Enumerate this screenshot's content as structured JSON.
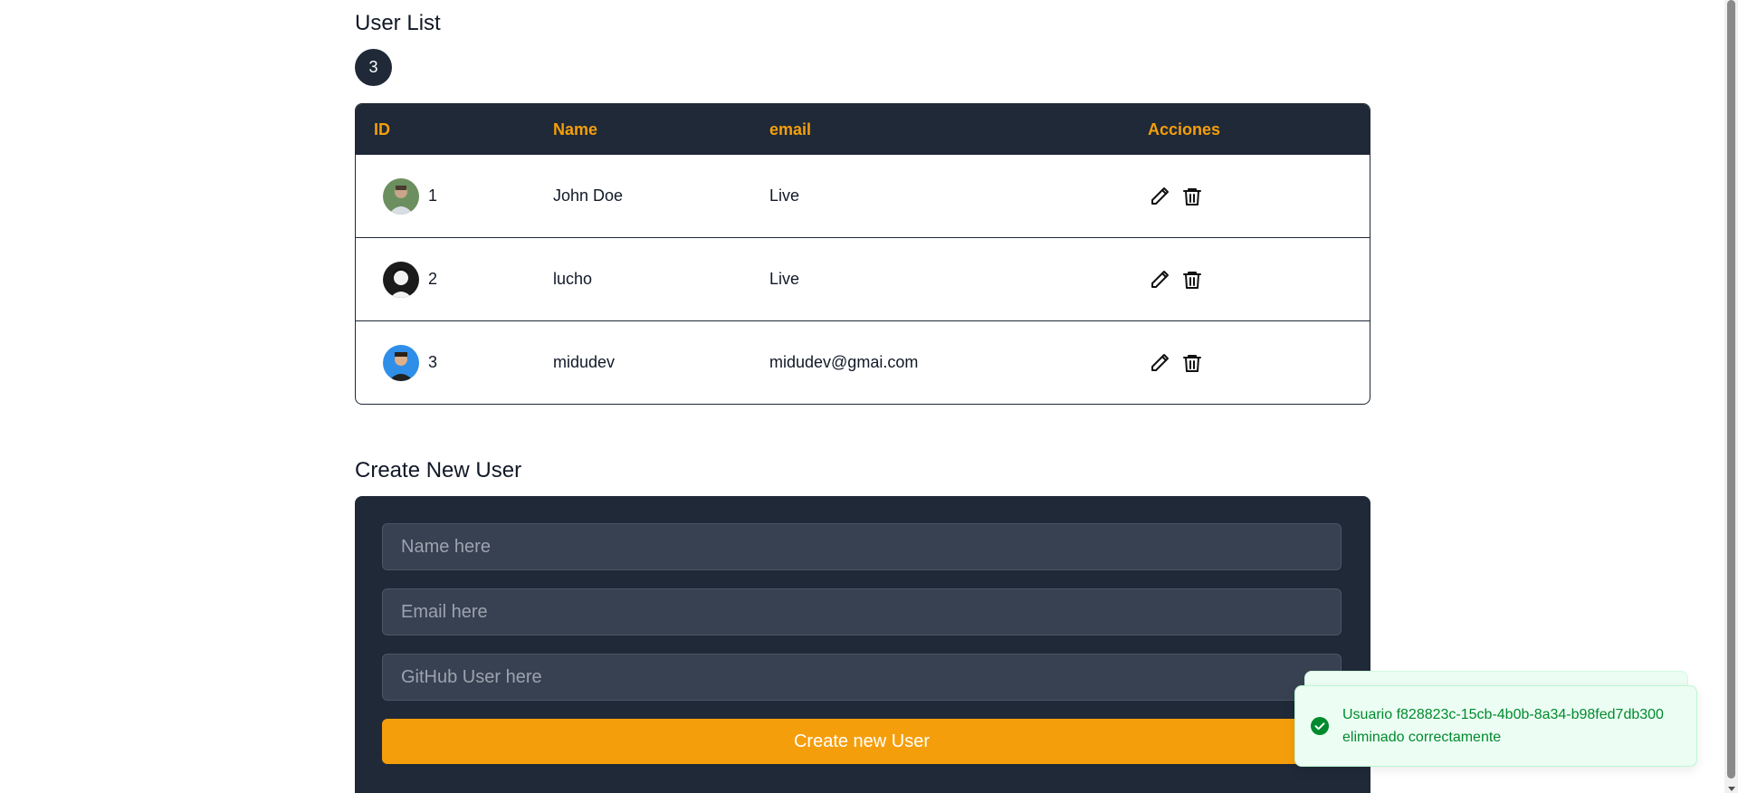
{
  "user_list": {
    "title": "User List",
    "count": "3",
    "columns": [
      "ID",
      "Name",
      "email",
      "Acciones"
    ],
    "rows": [
      {
        "id": "1",
        "name": "John Doe",
        "email": "Live",
        "avatar": "avatar-john-photo"
      },
      {
        "id": "2",
        "name": "lucho",
        "email": "Live",
        "avatar": "avatar-lucho-photo"
      },
      {
        "id": "3",
        "name": "midudev",
        "email": "midudev@gmai.com",
        "avatar": "avatar-midudev-photo"
      }
    ],
    "actions": {
      "edit_icon": "pencil-icon",
      "delete_icon": "trash-icon"
    }
  },
  "create_user": {
    "title": "Create New User",
    "name_placeholder": "Name here",
    "email_placeholder": "Email here",
    "github_placeholder": "GitHub User here",
    "submit_label": "Create new User"
  },
  "toast": {
    "message": "Usuario f828823c-15cb-4b0b-8a34-b98fed7db300 eliminado correctamente",
    "icon": "check-circle-icon"
  },
  "colors": {
    "header_bg": "#1f2937",
    "header_text": "#f59e0b",
    "button_bg": "#f59e0b",
    "toast_text": "#008a2e"
  }
}
